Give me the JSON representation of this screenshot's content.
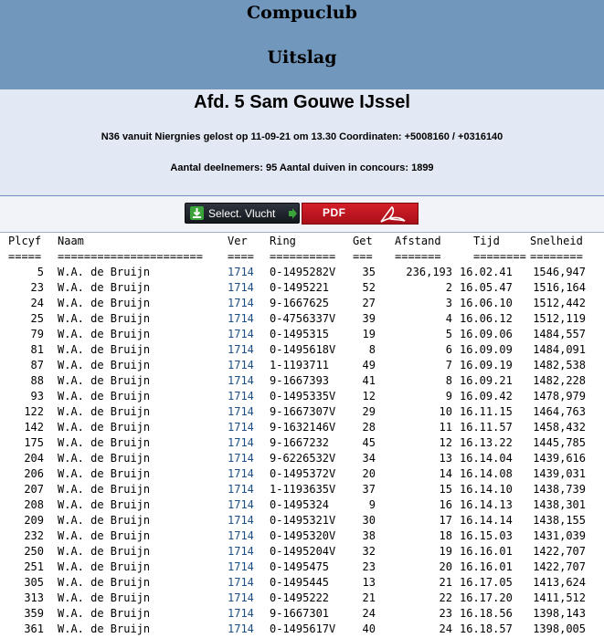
{
  "header": {
    "club": "Compuclub",
    "title": "Uitslag"
  },
  "info": {
    "afdeling": "Afd. 5 Sam Gouwe IJssel",
    "flight": "N36 vanuit Niergnies gelost op 11-09-21 om 13.30 Coordinaten: +5008160 / +0316140",
    "participants": "Aantal deelnemers: 95 Aantal duiven in concours: 1899"
  },
  "buttons": {
    "select_label": "Select. Vlucht",
    "pdf_label": "PDF"
  },
  "table": {
    "headers": {
      "plcyf": "Plcyf",
      "naam": "Naam",
      "ver": "Ver",
      "ring": "Ring",
      "get": "Get",
      "afstand": "Afstand",
      "tijd": "Tijd",
      "snelheid": "Snelheid"
    },
    "separators": {
      "plcyf": "=====",
      "naam": "======================",
      "ver": "====",
      "ring": "==========",
      "get": "===",
      "afstand": "=======",
      "tijd": "========",
      "snelheid": "========"
    },
    "rows": [
      {
        "plcyf": "5",
        "naam": "W.A. de Bruijn",
        "ver": "1714",
        "ring": "0-1495282V",
        "get": "35",
        "afstand": "236,193",
        "tijd": "16.02.41",
        "snelheid": "1546,947"
      },
      {
        "plcyf": "23",
        "naam": "W.A. de Bruijn",
        "ver": "1714",
        "ring": "0-1495221",
        "get": "52",
        "afstand": "2",
        "tijd": "16.05.47",
        "snelheid": "1516,164"
      },
      {
        "plcyf": "24",
        "naam": "W.A. de Bruijn",
        "ver": "1714",
        "ring": "9-1667625",
        "get": "27",
        "afstand": "3",
        "tijd": "16.06.10",
        "snelheid": "1512,442"
      },
      {
        "plcyf": "25",
        "naam": "W.A. de Bruijn",
        "ver": "1714",
        "ring": "0-4756337V",
        "get": "39",
        "afstand": "4",
        "tijd": "16.06.12",
        "snelheid": "1512,119"
      },
      {
        "plcyf": "79",
        "naam": "W.A. de Bruijn",
        "ver": "1714",
        "ring": "0-1495315",
        "get": "19",
        "afstand": "5",
        "tijd": "16.09.06",
        "snelheid": "1484,557"
      },
      {
        "plcyf": "81",
        "naam": "W.A. de Bruijn",
        "ver": "1714",
        "ring": "0-1495618V",
        "get": "8",
        "afstand": "6",
        "tijd": "16.09.09",
        "snelheid": "1484,091"
      },
      {
        "plcyf": "87",
        "naam": "W.A. de Bruijn",
        "ver": "1714",
        "ring": "1-1193711",
        "get": "49",
        "afstand": "7",
        "tijd": "16.09.19",
        "snelheid": "1482,538"
      },
      {
        "plcyf": "88",
        "naam": "W.A. de Bruijn",
        "ver": "1714",
        "ring": "9-1667393",
        "get": "41",
        "afstand": "8",
        "tijd": "16.09.21",
        "snelheid": "1482,228"
      },
      {
        "plcyf": "93",
        "naam": "W.A. de Bruijn",
        "ver": "1714",
        "ring": "0-1495335V",
        "get": "12",
        "afstand": "9",
        "tijd": "16.09.42",
        "snelheid": "1478,979"
      },
      {
        "plcyf": "122",
        "naam": "W.A. de Bruijn",
        "ver": "1714",
        "ring": "9-1667307V",
        "get": "29",
        "afstand": "10",
        "tijd": "16.11.15",
        "snelheid": "1464,763"
      },
      {
        "plcyf": "142",
        "naam": "W.A. de Bruijn",
        "ver": "1714",
        "ring": "9-1632146V",
        "get": "28",
        "afstand": "11",
        "tijd": "16.11.57",
        "snelheid": "1458,432"
      },
      {
        "plcyf": "175",
        "naam": "W.A. de Bruijn",
        "ver": "1714",
        "ring": "9-1667232",
        "get": "45",
        "afstand": "12",
        "tijd": "16.13.22",
        "snelheid": "1445,785"
      },
      {
        "plcyf": "204",
        "naam": "W.A. de Bruijn",
        "ver": "1714",
        "ring": "9-6226532V",
        "get": "34",
        "afstand": "13",
        "tijd": "16.14.04",
        "snelheid": "1439,616"
      },
      {
        "plcyf": "206",
        "naam": "W.A. de Bruijn",
        "ver": "1714",
        "ring": "0-1495372V",
        "get": "20",
        "afstand": "14",
        "tijd": "16.14.08",
        "snelheid": "1439,031"
      },
      {
        "plcyf": "207",
        "naam": "W.A. de Bruijn",
        "ver": "1714",
        "ring": "1-1193635V",
        "get": "37",
        "afstand": "15",
        "tijd": "16.14.10",
        "snelheid": "1438,739"
      },
      {
        "plcyf": "208",
        "naam": "W.A. de Bruijn",
        "ver": "1714",
        "ring": "0-1495324",
        "get": "9",
        "afstand": "16",
        "tijd": "16.14.13",
        "snelheid": "1438,301"
      },
      {
        "plcyf": "209",
        "naam": "W.A. de Bruijn",
        "ver": "1714",
        "ring": "0-1495321V",
        "get": "30",
        "afstand": "17",
        "tijd": "16.14.14",
        "snelheid": "1438,155"
      },
      {
        "plcyf": "232",
        "naam": "W.A. de Bruijn",
        "ver": "1714",
        "ring": "0-1495320V",
        "get": "38",
        "afstand": "18",
        "tijd": "16.15.03",
        "snelheid": "1431,039"
      },
      {
        "plcyf": "250",
        "naam": "W.A. de Bruijn",
        "ver": "1714",
        "ring": "0-1495204V",
        "get": "32",
        "afstand": "19",
        "tijd": "16.16.01",
        "snelheid": "1422,707"
      },
      {
        "plcyf": "251",
        "naam": "W.A. de Bruijn",
        "ver": "1714",
        "ring": "0-1495475",
        "get": "23",
        "afstand": "20",
        "tijd": "16.16.01",
        "snelheid": "1422,707"
      },
      {
        "plcyf": "305",
        "naam": "W.A. de Bruijn",
        "ver": "1714",
        "ring": "0-1495445",
        "get": "13",
        "afstand": "21",
        "tijd": "16.17.05",
        "snelheid": "1413,624"
      },
      {
        "plcyf": "313",
        "naam": "W.A. de Bruijn",
        "ver": "1714",
        "ring": "0-1495222",
        "get": "21",
        "afstand": "22",
        "tijd": "16.17.20",
        "snelheid": "1411,512"
      },
      {
        "plcyf": "359",
        "naam": "W.A. de Bruijn",
        "ver": "1714",
        "ring": "9-1667301",
        "get": "24",
        "afstand": "23",
        "tijd": "16.18.56",
        "snelheid": "1398,143"
      },
      {
        "plcyf": "361",
        "naam": "W.A. de Bruijn",
        "ver": "1714",
        "ring": "0-1495617V",
        "get": "40",
        "afstand": "24",
        "tijd": "16.18.57",
        "snelheid": "1398,005"
      }
    ]
  },
  "colors": {
    "header_bg": "#7197bd",
    "info_bg": "#e3e9f4",
    "link": "#1a4e84",
    "pdf_red": "#d41f29"
  }
}
